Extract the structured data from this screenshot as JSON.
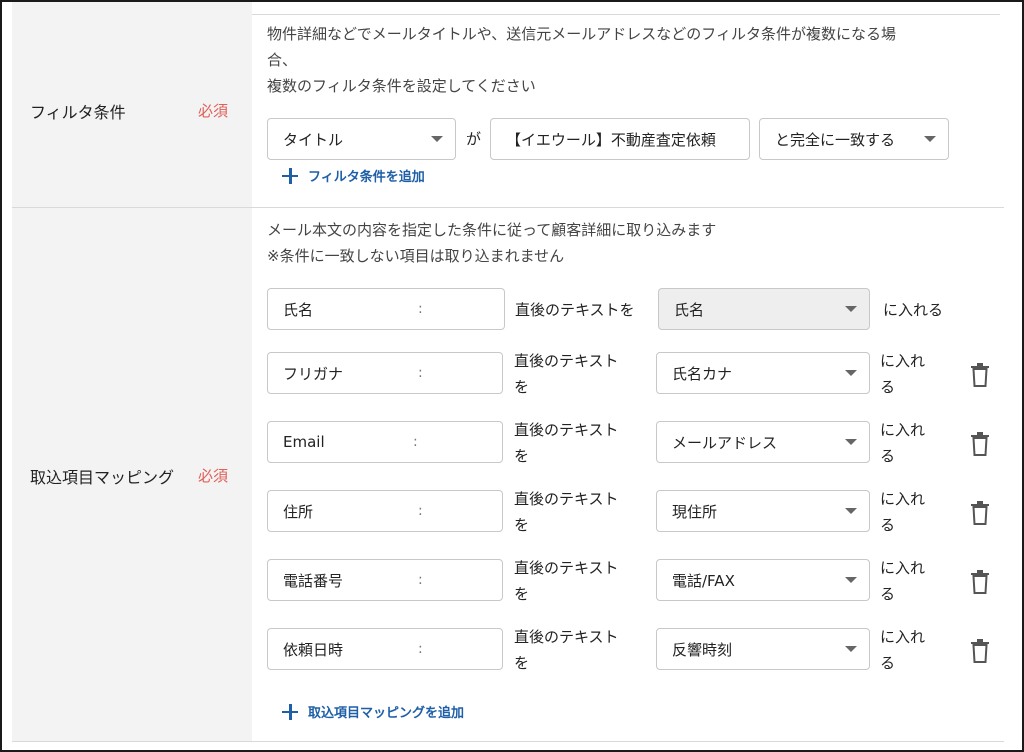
{
  "filter": {
    "label": "フィルタ条件",
    "required": "必須",
    "description": [
      "物件詳細などでメールタイトルや、送信元メールアドレスなどのフィルタ条件が複数になる場",
      "合、",
      "複数のフィルタ条件を設定してください"
    ],
    "field_select": "タイトル",
    "connector": "が",
    "value_input": "【イエウール】不動産査定依頼",
    "match_select": "と完全に一致する",
    "add_label": "フィルタ条件を追加"
  },
  "mapping": {
    "label": "取込項目マッピング",
    "required": "必須",
    "description": [
      "メール本文の内容を指定した条件に従って顧客詳細に取り込みます",
      "※条件に一致しない項目は取り込まれません"
    ],
    "rows": [
      {
        "source": "氏名",
        "colon": ":",
        "rule": "直後のテキストを",
        "target": "氏名",
        "suffix": "に入れる"
      },
      {
        "source": "フリガナ",
        "colon": ":",
        "rule_line1": "直後のテキスト",
        "rule_line2": "を",
        "target": "氏名カナ",
        "suffix_line1": "に入れ",
        "suffix_line2": "る"
      },
      {
        "source": "Email",
        "colon": ":",
        "rule_line1": "直後のテキスト",
        "rule_line2": "を",
        "target": "メールアドレス",
        "suffix_line1": "に入れ",
        "suffix_line2": "る"
      },
      {
        "source": "住所",
        "colon": ":",
        "rule_line1": "直後のテキスト",
        "rule_line2": "を",
        "target": "現住所",
        "suffix_line1": "に入れ",
        "suffix_line2": "る"
      },
      {
        "source": "電話番号",
        "colon": ":",
        "rule_line1": "直後のテキスト",
        "rule_line2": "を",
        "target": "電話/FAX",
        "suffix_line1": "に入れ",
        "suffix_line2": "る"
      },
      {
        "source": "依頼日時",
        "colon": ":",
        "rule_line1": "直後のテキスト",
        "rule_line2": "を",
        "target": "反響時刻",
        "suffix_line1": "に入れ",
        "suffix_line2": "る"
      }
    ],
    "add_label": "取込項目マッピングを追加"
  },
  "icons": {
    "delete": "trash-icon",
    "add": "plus-icon",
    "dropdown": "chevron-down-icon"
  },
  "colors": {
    "required": "#e0605a",
    "link": "#1e5fa8",
    "label_bg": "#f3f3f3"
  }
}
